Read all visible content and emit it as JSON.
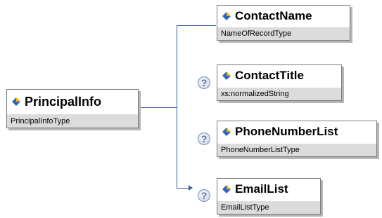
{
  "root": {
    "name": "PrincipalInfo",
    "type": "PrincipalInfoType"
  },
  "children": [
    {
      "name": "ContactName",
      "type": "NameOfRecordType",
      "optional": false
    },
    {
      "name": "ContactTitle",
      "type": "xs:normalizedString",
      "optional": true
    },
    {
      "name": "PhoneNumberList",
      "type": "PhoneNumberListType",
      "optional": true
    },
    {
      "name": "EmailList",
      "type": "EmailListType",
      "optional": true
    }
  ],
  "optional_marker": "?",
  "colors": {
    "connector": "#3b5ea8",
    "type_band": "#dcdcdc",
    "border": "#7a7a7a"
  }
}
